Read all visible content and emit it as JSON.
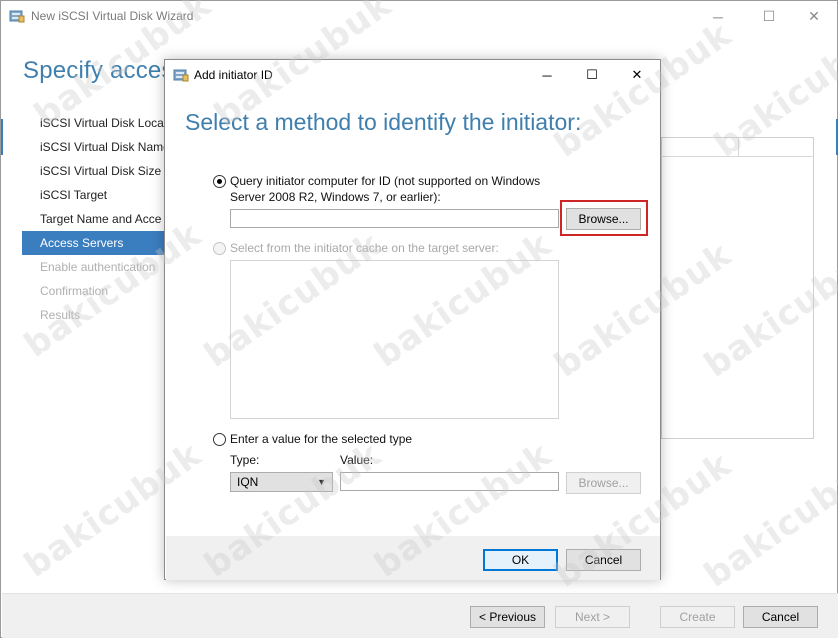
{
  "wizard": {
    "title": "New iSCSI Virtual Disk Wizard",
    "heading": "Specify access",
    "nav": [
      {
        "label": "iSCSI Virtual Disk Locat",
        "state": "normal"
      },
      {
        "label": "iSCSI Virtual Disk Name",
        "state": "normal"
      },
      {
        "label": "iSCSI Virtual Disk Size",
        "state": "normal"
      },
      {
        "label": "iSCSI Target",
        "state": "normal"
      },
      {
        "label": "Target Name and Acce",
        "state": "normal"
      },
      {
        "label": "Access Servers",
        "state": "active"
      },
      {
        "label": "Enable authentication",
        "state": "disabled"
      },
      {
        "label": "Confirmation",
        "state": "disabled"
      },
      {
        "label": "Results",
        "state": "disabled"
      }
    ],
    "buttons": {
      "previous": "< Previous",
      "next": "Next >",
      "create": "Create",
      "cancel": "Cancel"
    },
    "caption": {
      "minimize": "─",
      "maximize": "☐",
      "close": "✕"
    }
  },
  "dialog": {
    "title": "Add initiator ID",
    "heading": "Select a method to identify the initiator:",
    "caption": {
      "minimize": "─",
      "maximize": "☐",
      "close": "✕"
    },
    "option_query": {
      "label_line1": "Query initiator computer for ID (not supported on Windows",
      "label_line2": "Server 2008 R2, Windows 7, or earlier):",
      "input_value": "",
      "browse_label": "Browse..."
    },
    "option_cache": {
      "label": "Select from the initiator cache on the target server:"
    },
    "option_value": {
      "label": "Enter a value for the selected type",
      "type_label": "Type:",
      "value_label": "Value:",
      "type_selected": "IQN",
      "value_input": "",
      "browse_label": "Browse..."
    },
    "buttons": {
      "ok": "OK",
      "cancel": "Cancel"
    }
  },
  "colors": {
    "accent": "#3b7ec0",
    "heading": "#3f7fae",
    "highlight": "#d02525"
  },
  "watermark": "bakicubuk"
}
